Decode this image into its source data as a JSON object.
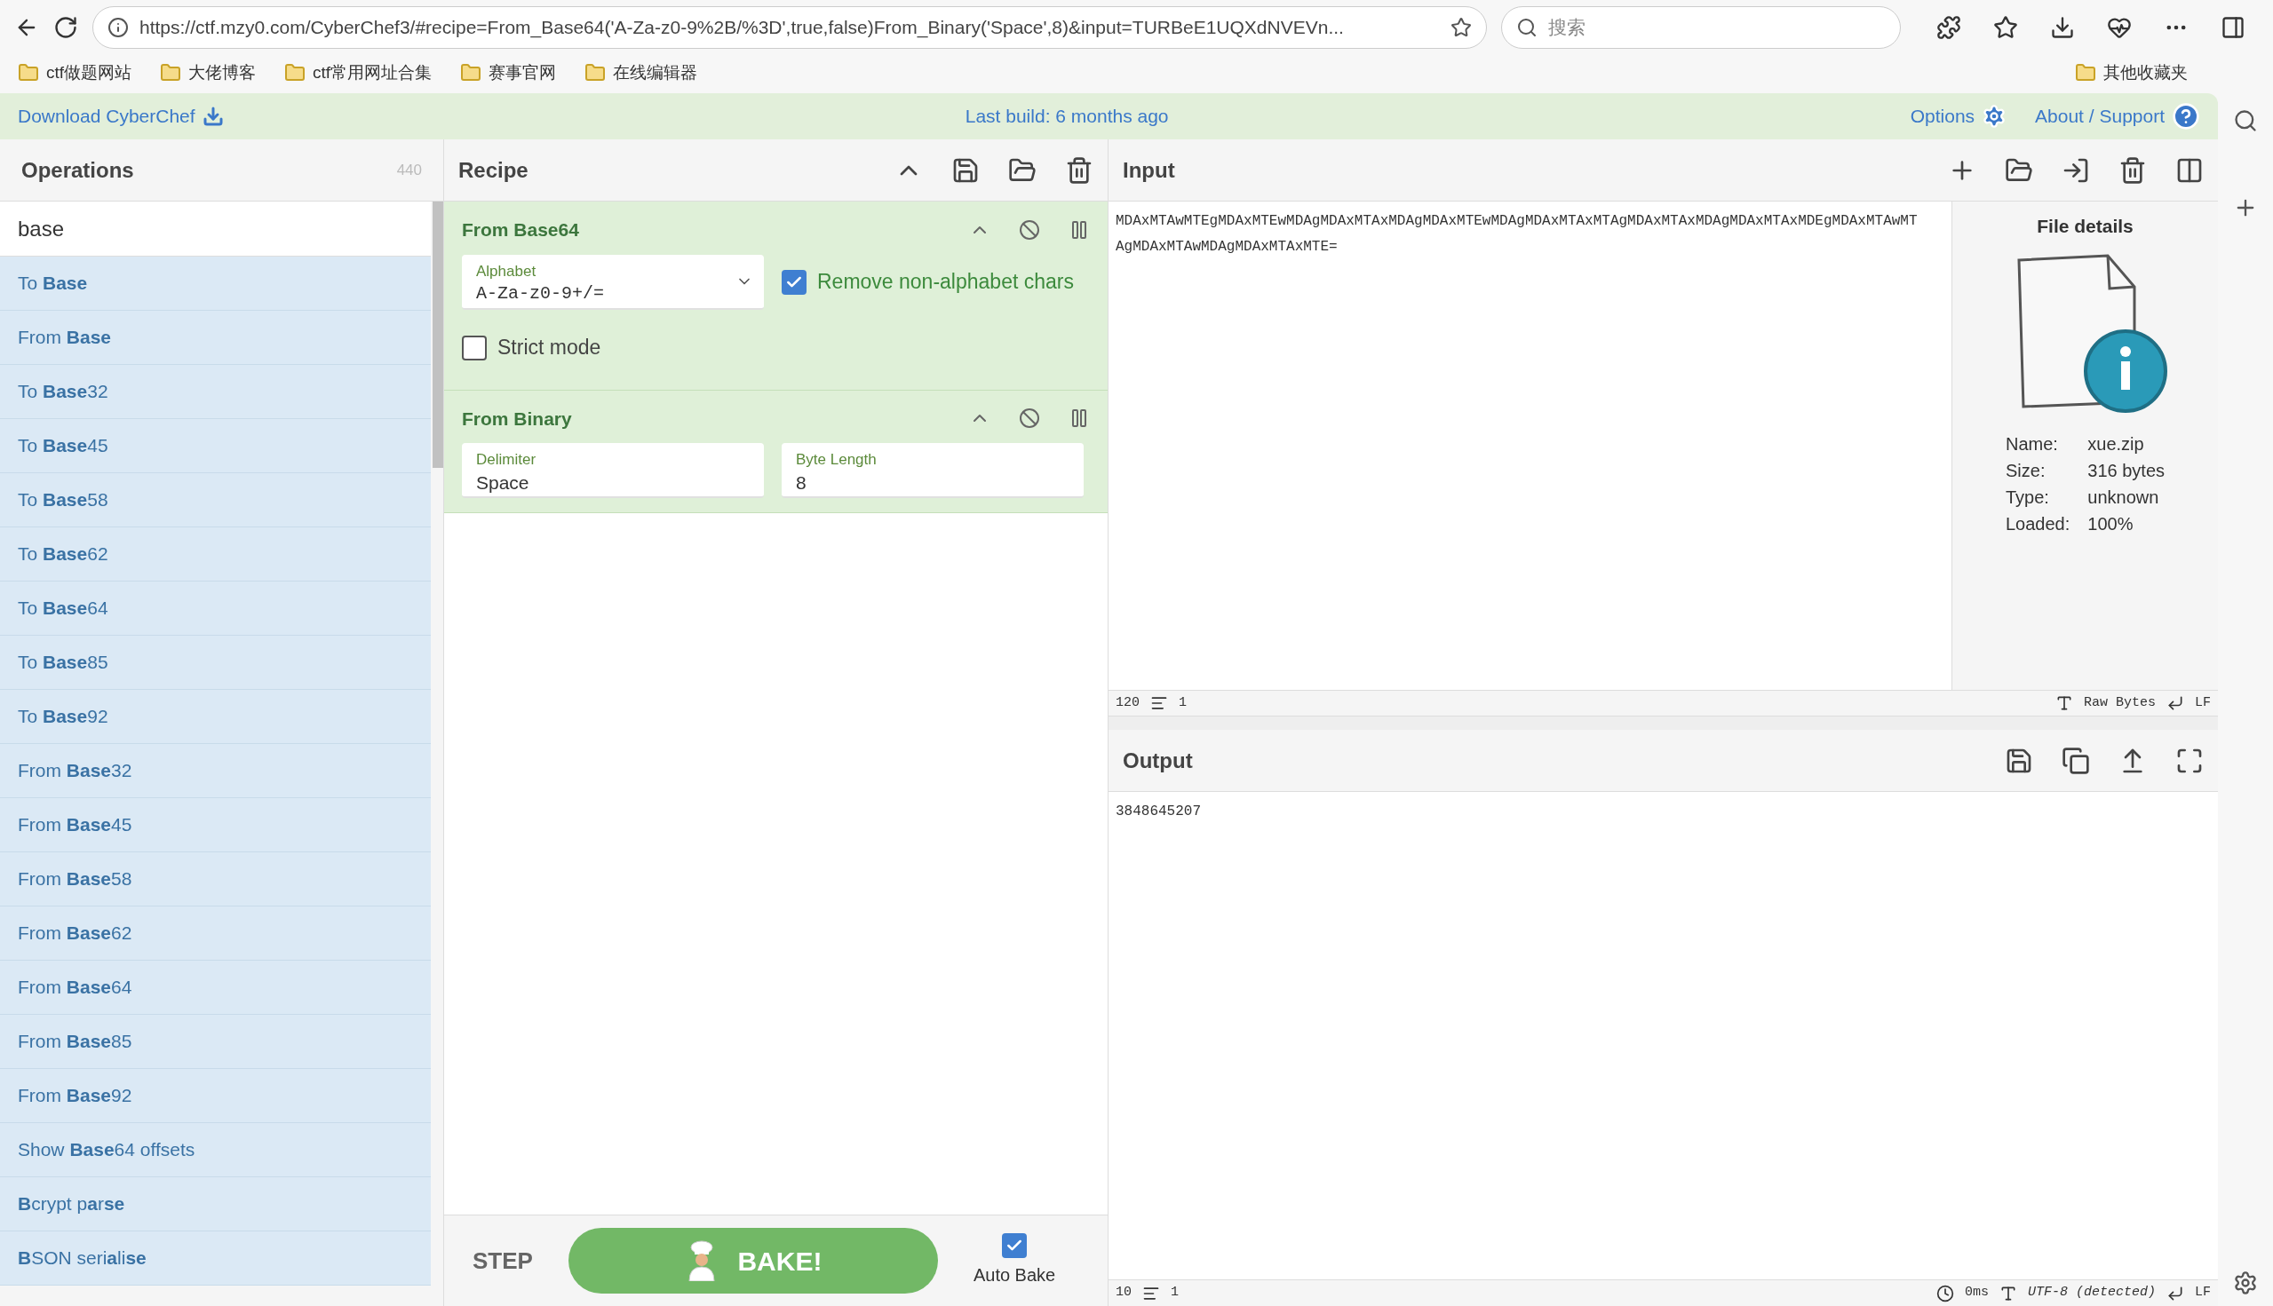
{
  "browser": {
    "url": "https://ctf.mzy0.com/CyberChef3/#recipe=From_Base64('A-Za-z0-9%2B/%3D',true,false)From_Binary('Space',8)&input=TURBeE1UQXdNVEVn...",
    "search_placeholder": "搜索",
    "bookmarks": [
      "ctf做题网站",
      "大佬博客",
      "ctf常用网址合集",
      "赛事官网",
      "在线编辑器"
    ],
    "other_bookmarks": "其他收藏夹"
  },
  "banner": {
    "download": "Download CyberChef",
    "build": "Last build: 6 months ago",
    "options": "Options",
    "about": "About / Support"
  },
  "operations": {
    "title": "Operations",
    "count": "440",
    "search_value": "base",
    "items": [
      "To **Base**",
      "From **Base**",
      "To **Base**32",
      "To **Base**45",
      "To **Base**58",
      "To **Base**62",
      "To **Base**64",
      "To **Base**85",
      "To **Base**92",
      "From **Base**32",
      "From **Base**45",
      "From **Base**58",
      "From **Base**62",
      "From **Base**64",
      "From **Base**85",
      "From **Base**92",
      "Show **Base**64 offsets",
      "**B**crypt p**a**r**se**",
      "**B**SON seri**a**li**se**"
    ]
  },
  "recipe": {
    "title": "Recipe",
    "ops": [
      {
        "name": "From Base64",
        "rows": [
          [
            {
              "kind": "dropdown",
              "label": "Alphabet",
              "value": "A-Za-z0-9+/="
            },
            {
              "kind": "checkbox",
              "label": "Remove non-alphabet chars",
              "checked": true
            }
          ],
          [
            {
              "kind": "checkbox",
              "label": "Strict mode",
              "checked": false
            }
          ]
        ]
      },
      {
        "name": "From Binary",
        "rows": [
          [
            {
              "kind": "text",
              "label": "Delimiter",
              "value": "Space"
            },
            {
              "kind": "text",
              "label": "Byte Length",
              "value": "8"
            }
          ]
        ]
      }
    ],
    "step": "STEP",
    "bake": "BAKE!",
    "auto_bake": {
      "label": "Auto Bake",
      "checked": true
    }
  },
  "input": {
    "title": "Input",
    "text": "MDAxMTAwMTEgMDAxMTEwMDAgMDAxMTAxMDAgMDAxMTEwMDAgMDAxMTAxMTAgMDAxMTAxMDAgMDAxMTAxMDEgMDAxMTAwMTAgMDAxMTAwMDAgMDAxMTAxMTE=",
    "file": {
      "title": "File details",
      "rows": [
        {
          "label": "Name:",
          "value": "xue.zip"
        },
        {
          "label": "Size:",
          "value": "316 bytes"
        },
        {
          "label": "Type:",
          "value": "unknown"
        },
        {
          "label": "Loaded:",
          "value": "100%"
        }
      ]
    },
    "status": {
      "chars": "120",
      "lines": "1",
      "encoding": "Raw Bytes",
      "eol": "LF"
    }
  },
  "output": {
    "title": "Output",
    "text": "3848645207",
    "status": {
      "chars": "10",
      "lines": "1",
      "time": "0ms",
      "encoding": "UTF-8 (detected)",
      "eol": "LF"
    }
  }
}
